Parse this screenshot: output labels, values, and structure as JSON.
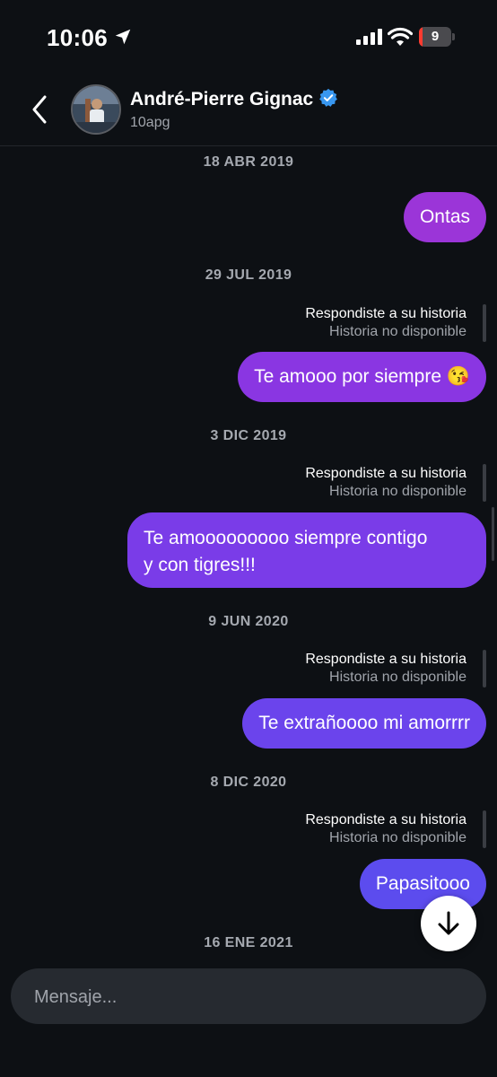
{
  "status_bar": {
    "time": "10:06",
    "battery_level": "9",
    "battery_fraction": 0.09,
    "battery_color": "#ff3b30"
  },
  "header": {
    "name": "André-Pierre Gignac",
    "username": "10apg",
    "verified_color": "#3897f0"
  },
  "messages": [
    {
      "date": "18 ABR 2019",
      "text": "Ontas",
      "color": "#9b35d8"
    },
    {
      "date": "29 JUL 2019",
      "reply_label": "Respondiste a su historia",
      "reply_sub": "Historia no disponible",
      "text": "Te amooo por siempre 😘",
      "color": "#8a36e2"
    },
    {
      "date": "3 DIC 2019",
      "reply_label": "Respondiste a su historia",
      "reply_sub": "Historia no disponible",
      "text_lines": [
        "Te amooooooooo siempre contigo",
        "y con tigres!!!"
      ],
      "color": "#7a3ce8"
    },
    {
      "date": "9 JUN 2020",
      "reply_label": "Respondiste a su historia",
      "reply_sub": "Historia no disponible",
      "text": "Te extrañoooo mi amorrrr",
      "color": "#6b44ec"
    },
    {
      "date": "8 DIC 2020",
      "reply_label": "Respondiste a su historia",
      "reply_sub": "Historia no disponible",
      "text": "Papasitooo",
      "color": "#5c4cee"
    },
    {
      "date": "16 ENE 2021"
    }
  ],
  "composer": {
    "placeholder": "Mensaje..."
  }
}
